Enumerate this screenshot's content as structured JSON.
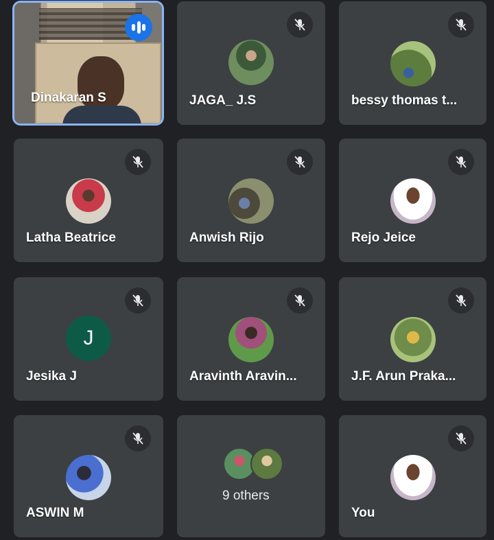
{
  "meeting": {
    "tiles": [
      {
        "name": "Dinakaran S",
        "state": "speaking",
        "icon": "audio-bars-icon"
      },
      {
        "name": "JAGA_ J.S",
        "state": "muted",
        "icon": "mic-off-icon"
      },
      {
        "name": "bessy thomas t...",
        "state": "muted",
        "icon": "mic-off-icon"
      },
      {
        "name": "Latha Beatrice",
        "state": "muted",
        "icon": "mic-off-icon"
      },
      {
        "name": "Anwish Rijo",
        "state": "muted",
        "icon": "mic-off-icon"
      },
      {
        "name": "Rejo Jeice",
        "state": "muted",
        "icon": "mic-off-icon"
      },
      {
        "name": "Jesika J",
        "state": "muted",
        "icon": "mic-off-icon",
        "avatar_letter": "J"
      },
      {
        "name": "Aravinth Aravin...",
        "state": "muted",
        "icon": "mic-off-icon"
      },
      {
        "name": "J.F. Arun Praka...",
        "state": "muted",
        "icon": "mic-off-icon"
      },
      {
        "name": "ASWIN M",
        "state": "muted",
        "icon": "mic-off-icon"
      },
      {
        "others_label": "9 others"
      },
      {
        "name": "You",
        "state": "muted",
        "icon": "mic-off-icon"
      }
    ]
  },
  "colors": {
    "background": "#202124",
    "tile": "#3c4043",
    "active_border": "#8ab4f8",
    "speaking_badge": "#1a73e8",
    "letter_avatar": "#0d5b47"
  }
}
